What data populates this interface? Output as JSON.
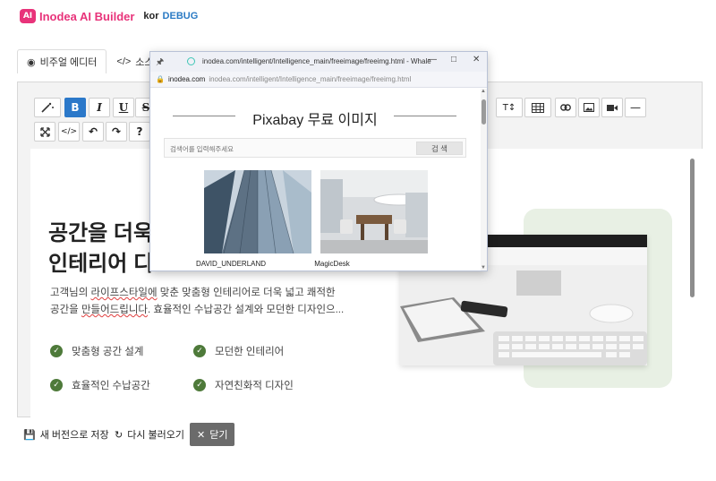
{
  "header": {
    "logo": "AI",
    "title": "Inodea AI Builder",
    "lang": "kor",
    "debug": "DEBUG"
  },
  "tabs": [
    {
      "label": "비주얼 에디터",
      "icon": "eye-icon"
    },
    {
      "label": "소스 코드",
      "icon": "code-icon"
    }
  ],
  "toolbar": {
    "magic": "magic-wand-icon",
    "bold": "B",
    "italic": "I",
    "underline": "U",
    "strike": "S",
    "fontsize": "T↕",
    "table": "▦",
    "link": "🔗",
    "image": "🖼",
    "video": "■",
    "hr": "—",
    "fullscreen": "⤧",
    "codeview": "</>",
    "undo": "↶",
    "redo": "↷",
    "help": "?"
  },
  "content": {
    "title_line1": "공간을 더욱",
    "title_line2": "인테리어 디",
    "desc_line1_a": "고객님의 ",
    "desc_line1_b": "라이프스타일에",
    "desc_line1_c": " 맞춘 맞춤형 인테리어로 더욱 넓고 쾌적한",
    "desc_line2_a": "공간을 ",
    "desc_line2_b": "만들어드립니다",
    "desc_line2_c": ". 효율적인 수납공간 설계와 모던한 디자인으...",
    "features": [
      "맞춤형 공간 설계",
      "모던한 인테리어",
      "효율적인 수납공간",
      "자연친화적 디자인"
    ]
  },
  "bottom": {
    "save": "새 버전으로 저장",
    "reload": "다시 불러오기",
    "close": "닫기"
  },
  "popup": {
    "window_title": "inodea.com/intelligent/Intelligence_main/freeimage/freeimg.html - Whale",
    "url_host": "inodea.com",
    "url_path": "inodea.com/intelligent/Intelligence_main/freeimage/freeimg.html",
    "heading": "Pixabay 무료 이미지",
    "search_placeholder": "검색어를 입력해주세요",
    "search_button": "검 색",
    "images": [
      {
        "caption": "DAVID_UNDERLAND"
      },
      {
        "caption": "MagicDesk"
      }
    ]
  },
  "colors": {
    "brand": "#e8337a",
    "debug": "#2a7ac4",
    "accent": "#2b78c9",
    "check": "#4e7a3a"
  }
}
